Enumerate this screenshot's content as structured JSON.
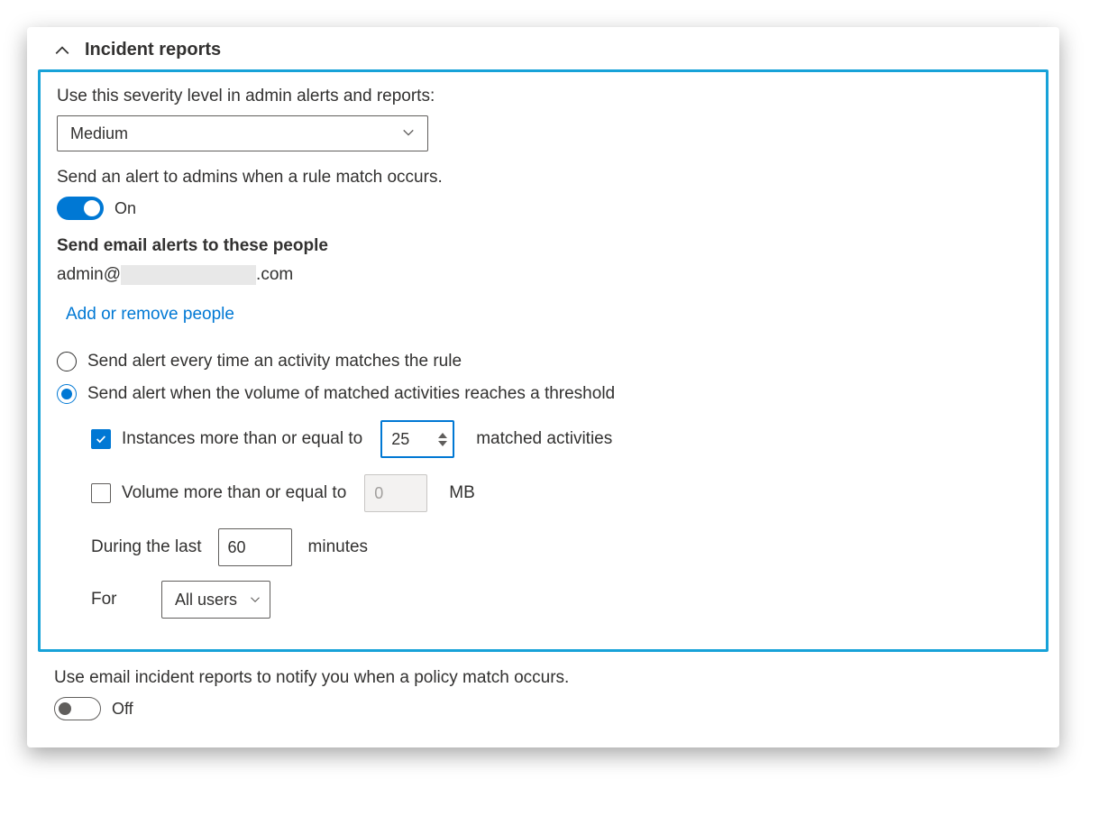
{
  "section": {
    "title": "Incident reports"
  },
  "severity": {
    "label": "Use this severity level in admin alerts and reports:",
    "value": "Medium"
  },
  "alertAdmins": {
    "label": "Send an alert to admins when a rule match occurs.",
    "state": "On"
  },
  "emailAlerts": {
    "label": "Send email alerts to these people",
    "prefix": "admin@",
    "suffix": ".com",
    "addRemoveLink": "Add or remove people"
  },
  "alertFrequency": {
    "optionEvery": "Send alert every time an activity matches the rule",
    "optionThreshold": "Send alert when the volume of matched activities reaches a threshold"
  },
  "threshold": {
    "instancesLabel": "Instances more than or equal to",
    "instancesValue": "25",
    "instancesSuffix": "matched activities",
    "volumeLabel": "Volume more than or equal to",
    "volumePlaceholder": "0",
    "volumeUnit": "MB",
    "duringLabel": "During the last",
    "duringValue": "60",
    "duringUnit": "minutes",
    "forLabel": "For",
    "forValue": "All users"
  },
  "incidentEmail": {
    "label": "Use email incident reports to notify you when a policy match occurs.",
    "state": "Off"
  }
}
